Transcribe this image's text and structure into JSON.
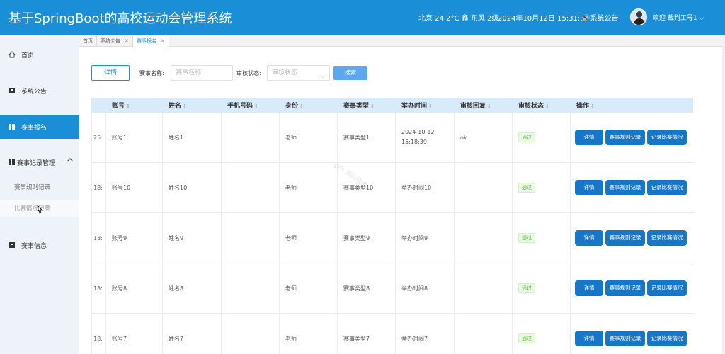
{
  "header": {
    "title": "基于SpringBoot的高校运动会管理系统",
    "weather": "北京 24.2°C 鑫 东风 2级",
    "datetime": "2024年10月12日 15:31:31",
    "notice": "🔊系统公告",
    "welcome": "欢迎 裁判工号1 ⌵"
  },
  "sidebar": {
    "items": [
      {
        "label": "首页"
      },
      {
        "label": "系统公告"
      },
      {
        "label": "赛事报名"
      },
      {
        "label": "赛事记录管理"
      },
      {
        "label": "赛事信息"
      }
    ],
    "sub_items": [
      {
        "label": "赛事规则记录"
      },
      {
        "label": "比赛情况记录"
      }
    ],
    "collapse_icon": "^"
  },
  "tabs": [
    {
      "label": "首页"
    },
    {
      "label": "系统公告",
      "close": "✕"
    },
    {
      "label": "赛事报名",
      "close": "✕"
    }
  ],
  "toolbar": {
    "detail_label": "详情",
    "name_label": "赛事名称:",
    "name_placeholder": "赛事名称",
    "status_label": "审核状态:",
    "status_placeholder": "审核状态",
    "search_label": "搜索"
  },
  "table": {
    "columns": [
      "",
      "账号",
      "姓名",
      "手机号码",
      "身份",
      "赛事类型",
      "举办时间",
      "审核回复",
      "审核状态",
      "操作"
    ],
    "rows": [
      {
        "id": "25:",
        "account": "账号1",
        "name": "姓名1",
        "phone": "",
        "role": "老师",
        "type": "赛事类型1",
        "time": "2024-10-12 15:18:39",
        "reply": "ok",
        "status": "通过"
      },
      {
        "id": "18:",
        "account": "账号10",
        "name": "姓名10",
        "phone": "",
        "role": "老师",
        "type": "赛事类型10",
        "time": "举办时间10",
        "reply": "",
        "status": "通过"
      },
      {
        "id": "18:",
        "account": "账号9",
        "name": "姓名9",
        "phone": "",
        "role": "老师",
        "type": "赛事类型9",
        "time": "举办时间9",
        "reply": "",
        "status": "通过"
      },
      {
        "id": "18:",
        "account": "账号8",
        "name": "姓名8",
        "phone": "",
        "role": "老师",
        "type": "赛事类型8",
        "time": "举办时间8",
        "reply": "",
        "status": "通过"
      },
      {
        "id": "18:",
        "account": "账号7",
        "name": "姓名7",
        "phone": "",
        "role": "老师",
        "type": "赛事类型7",
        "time": "举办时间7",
        "reply": "",
        "status": "通过"
      }
    ],
    "actions": [
      "详情",
      "赛事规则记录",
      "记录比赛情况"
    ]
  },
  "watermark": "gzh 源码技术",
  "colors": {
    "primary": "#1a8fd8",
    "button": "#1677c9",
    "success": "#67c23a"
  }
}
